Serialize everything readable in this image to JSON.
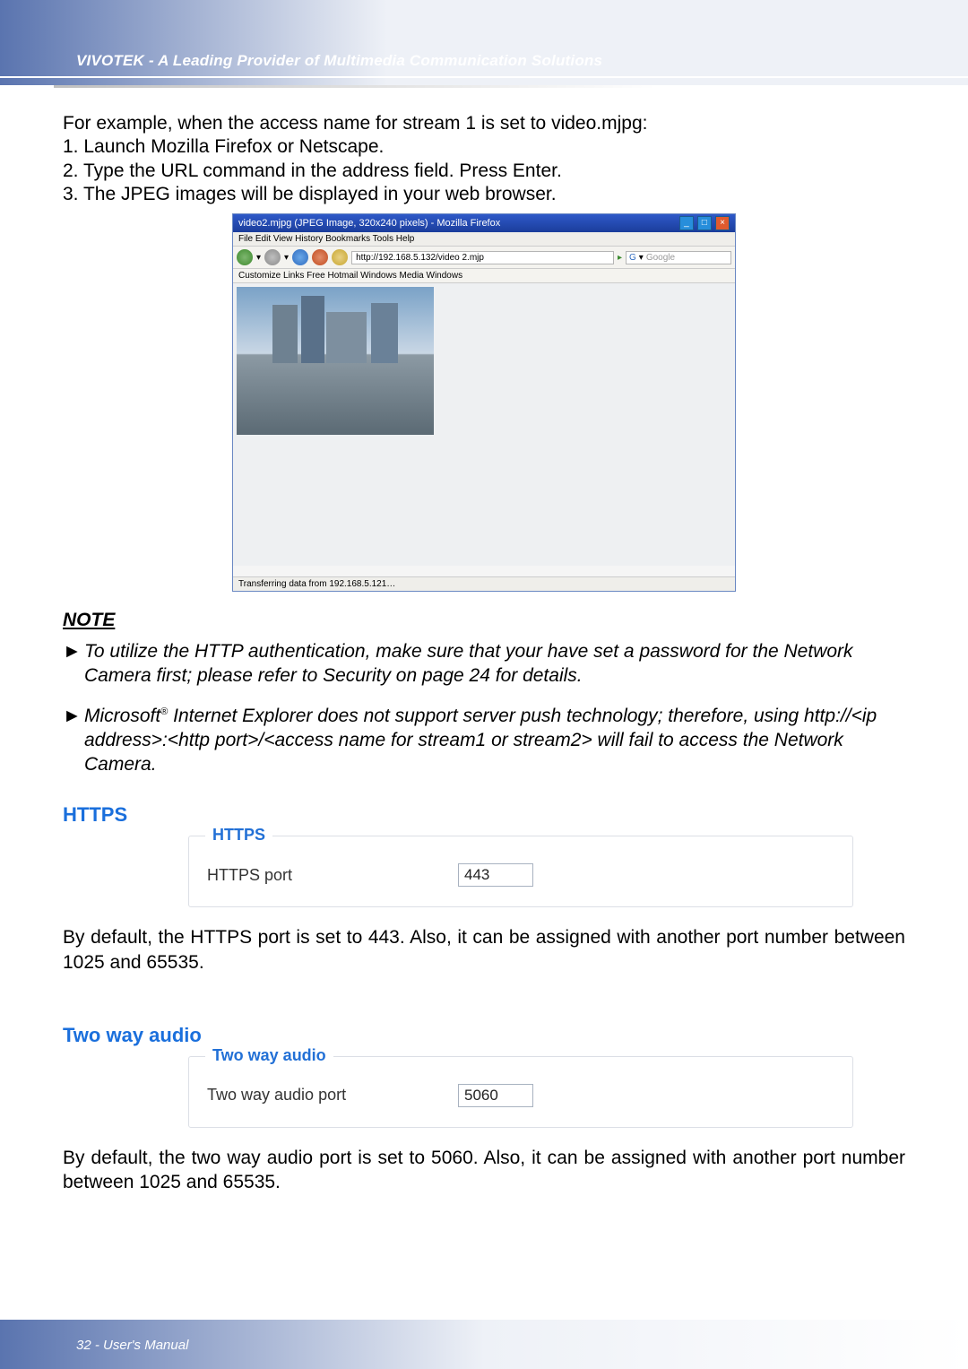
{
  "header": {
    "brand_line": "VIVOTEK - A Leading Provider of Multimedia Communication Solutions"
  },
  "intro": {
    "line": "For example, when the access name for stream 1 is set to video.mjpg:",
    "step1": "1. Launch Mozilla Firefox or Netscape.",
    "step2": "2. Type the URL command in the address field. Press Enter.",
    "step3": "3. The JPEG images will be displayed in your web browser."
  },
  "figure": {
    "title": "video2.mjpg (JPEG Image, 320x240 pixels) - Mozilla Firefox",
    "menu": "File   Edit   View   History   Bookmarks   Tools   Help",
    "url": "http://192.168.5.132/video 2.mjp",
    "bookmarks": "Customize Links   Free Hotmail   Windows Media   Windows",
    "status": "Transferring data from 192.168.5.121…"
  },
  "note": {
    "heading": "NOTE",
    "item1": "To utilize the HTTP authentication, make sure that your have set a password for the Network Camera first; please refer to Security on page 24  for details.",
    "item2_a": "Microsoft",
    "item2_b": " Internet Explorer does not support server push technology; therefore, using http://<ip address>:<http port>/<access name for stream1 or stream2> will fail to access the Network Camera."
  },
  "https": {
    "heading": "HTTPS",
    "legend": "HTTPS",
    "label": "HTTPS port",
    "value": "443",
    "desc": "By default, the HTTPS port is set to 443. Also, it can be assigned with another port number between 1025 and 65535."
  },
  "twa": {
    "heading": "Two way audio",
    "legend": "Two way audio",
    "label": "Two way audio port",
    "value": "5060",
    "desc": "By default, the two way audio port is set to 5060. Also, it can be assigned with another port number between 1025 and 65535."
  },
  "footer": {
    "text": "32 - User's Manual"
  }
}
